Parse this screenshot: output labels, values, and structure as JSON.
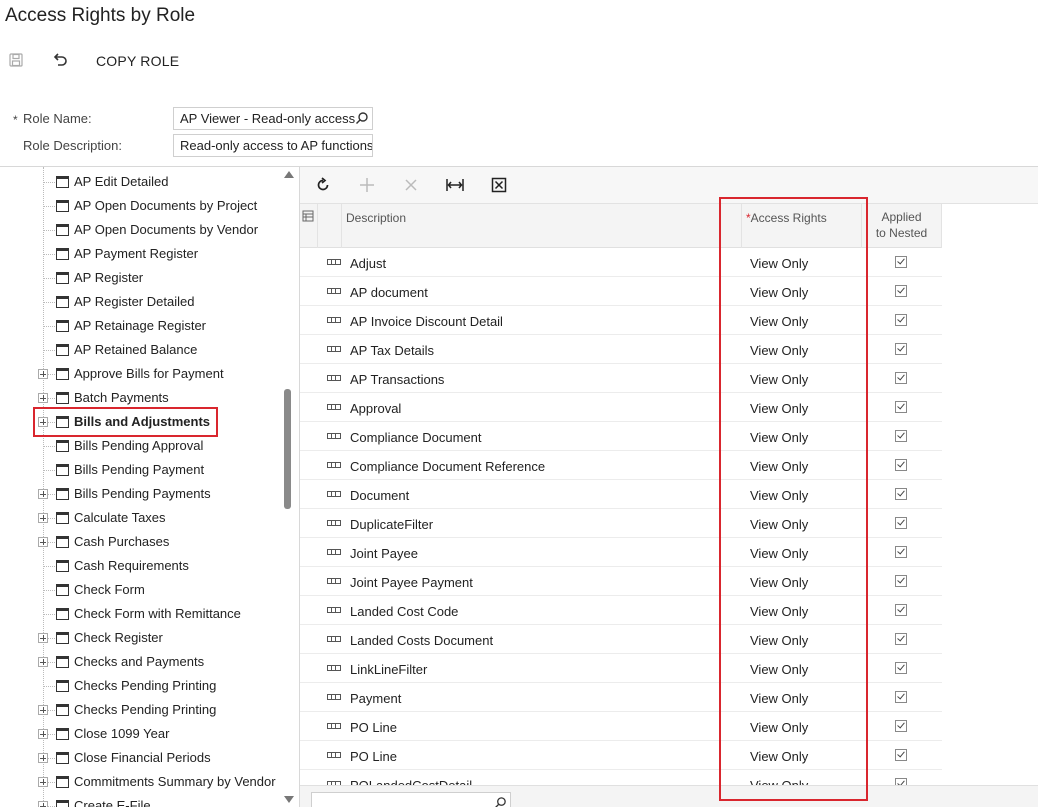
{
  "page": {
    "title": "Access Rights by Role"
  },
  "toolbar": {
    "copy_role_label": "COPY ROLE"
  },
  "form": {
    "role_name_label": "Role Name:",
    "role_name_value": "AP Viewer - Read-only access",
    "role_description_label": "Role Description:",
    "role_description_value": "Read-only access to AP functions"
  },
  "tree": {
    "items": [
      {
        "label": "AP Edit Detailed",
        "expandable": false,
        "selected": false
      },
      {
        "label": "AP Open Documents by Project",
        "expandable": false,
        "selected": false
      },
      {
        "label": "AP Open Documents by Vendor",
        "expandable": false,
        "selected": false
      },
      {
        "label": "AP Payment Register",
        "expandable": false,
        "selected": false
      },
      {
        "label": "AP Register",
        "expandable": false,
        "selected": false
      },
      {
        "label": "AP Register Detailed",
        "expandable": false,
        "selected": false
      },
      {
        "label": "AP Retainage Register",
        "expandable": false,
        "selected": false
      },
      {
        "label": "AP Retained Balance",
        "expandable": false,
        "selected": false
      },
      {
        "label": "Approve Bills for Payment",
        "expandable": true,
        "selected": false
      },
      {
        "label": "Batch Payments",
        "expandable": true,
        "selected": false
      },
      {
        "label": "Bills and Adjustments",
        "expandable": true,
        "selected": true
      },
      {
        "label": "Bills Pending Approval",
        "expandable": false,
        "selected": false
      },
      {
        "label": "Bills Pending Payment",
        "expandable": false,
        "selected": false
      },
      {
        "label": "Bills Pending Payments",
        "expandable": true,
        "selected": false
      },
      {
        "label": "Calculate Taxes",
        "expandable": true,
        "selected": false
      },
      {
        "label": "Cash Purchases",
        "expandable": true,
        "selected": false
      },
      {
        "label": "Cash Requirements",
        "expandable": false,
        "selected": false
      },
      {
        "label": "Check Form",
        "expandable": false,
        "selected": false
      },
      {
        "label": "Check Form with Remittance",
        "expandable": false,
        "selected": false
      },
      {
        "label": "Check Register",
        "expandable": true,
        "selected": false
      },
      {
        "label": "Checks and Payments",
        "expandable": true,
        "selected": false
      },
      {
        "label": "Checks Pending Printing",
        "expandable": false,
        "selected": false
      },
      {
        "label": "Checks Pending Printing",
        "expandable": true,
        "selected": false
      },
      {
        "label": "Close 1099 Year",
        "expandable": true,
        "selected": false
      },
      {
        "label": "Close Financial Periods",
        "expandable": true,
        "selected": false
      },
      {
        "label": "Commitments Summary by Vendor",
        "expandable": true,
        "selected": false
      },
      {
        "label": "Create E-File",
        "expandable": true,
        "selected": false
      }
    ]
  },
  "grid": {
    "columns": {
      "description": "Description",
      "access_rights": "Access Rights",
      "applied_nested_line1": "Applied",
      "applied_nested_line2": "to Nested"
    },
    "rows": [
      {
        "description": "Adjust",
        "access_rights": "View Only",
        "applied": true
      },
      {
        "description": "AP document",
        "access_rights": "View Only",
        "applied": true
      },
      {
        "description": "AP Invoice Discount Detail",
        "access_rights": "View Only",
        "applied": true
      },
      {
        "description": "AP Tax Details",
        "access_rights": "View Only",
        "applied": true
      },
      {
        "description": "AP Transactions",
        "access_rights": "View Only",
        "applied": true
      },
      {
        "description": "Approval",
        "access_rights": "View Only",
        "applied": true
      },
      {
        "description": "Compliance Document",
        "access_rights": "View Only",
        "applied": true
      },
      {
        "description": "Compliance Document Reference",
        "access_rights": "View Only",
        "applied": true
      },
      {
        "description": "Document",
        "access_rights": "View Only",
        "applied": true
      },
      {
        "description": "DuplicateFilter",
        "access_rights": "View Only",
        "applied": true
      },
      {
        "description": "Joint Payee",
        "access_rights": "View Only",
        "applied": true
      },
      {
        "description": "Joint Payee Payment",
        "access_rights": "View Only",
        "applied": true
      },
      {
        "description": "Landed Cost Code",
        "access_rights": "View Only",
        "applied": true
      },
      {
        "description": "Landed Costs Document",
        "access_rights": "View Only",
        "applied": true
      },
      {
        "description": "LinkLineFilter",
        "access_rights": "View Only",
        "applied": true
      },
      {
        "description": "Payment",
        "access_rights": "View Only",
        "applied": true
      },
      {
        "description": "PO Line",
        "access_rights": "View Only",
        "applied": true
      },
      {
        "description": "PO Line",
        "access_rights": "View Only",
        "applied": true
      },
      {
        "description": "POLandedCostDetail",
        "access_rights": "View Only",
        "applied": true
      }
    ]
  },
  "colors": {
    "highlight": "#d9262e",
    "required": "#d9262e"
  }
}
